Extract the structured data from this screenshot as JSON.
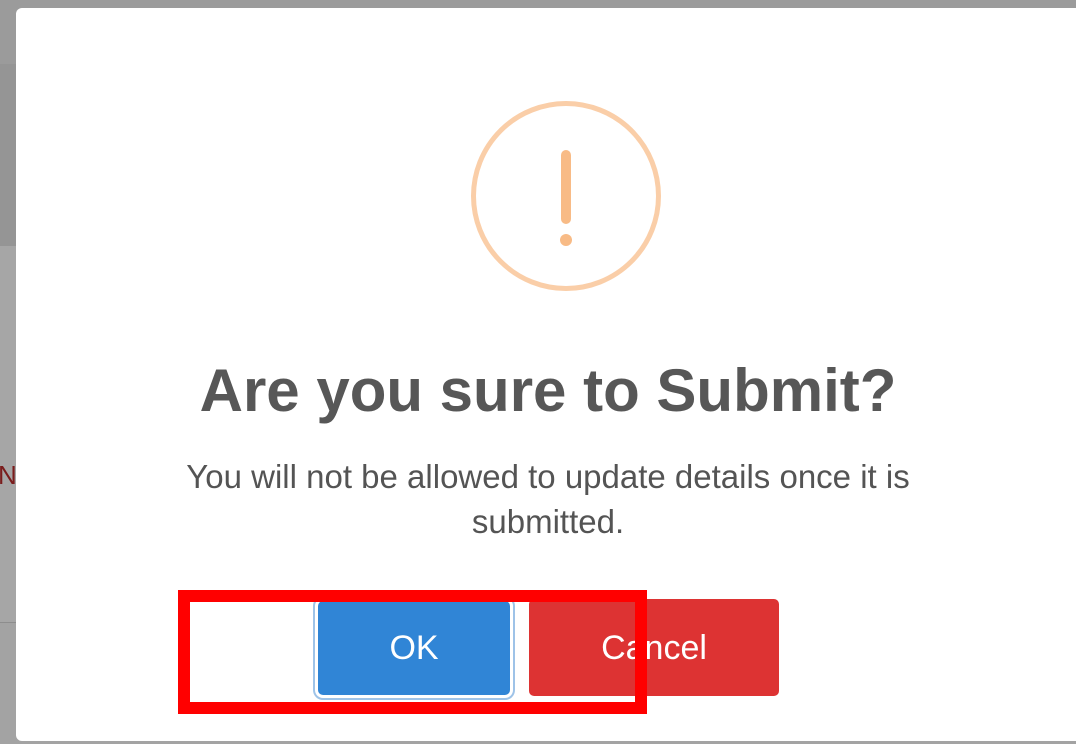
{
  "background": {
    "partial_text": "N"
  },
  "modal": {
    "icon": "warning-exclamation-icon",
    "icon_color": "#f8bb86",
    "icon_ring_color": "#facea8",
    "title": "Are you sure to Submit?",
    "text": "You will not be allowed to update details once it is submitted.",
    "ok_label": "OK",
    "cancel_label": "Cancel",
    "ok_color": "#3085d6",
    "cancel_color": "#dd3333"
  },
  "annotation": {
    "color": "#ff0000"
  }
}
